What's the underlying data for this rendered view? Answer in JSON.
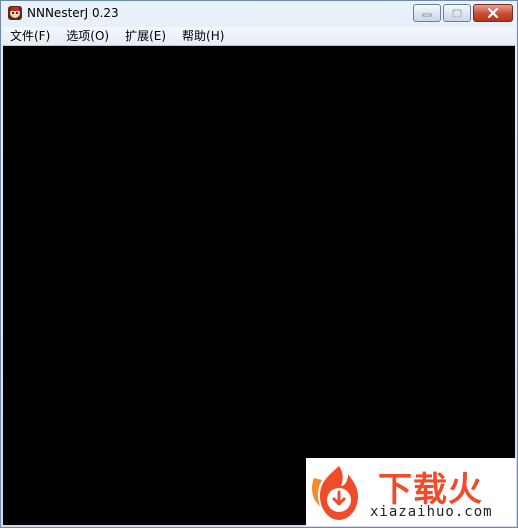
{
  "window": {
    "title": "NNNesterJ 0.23",
    "icon": "app-icon"
  },
  "controls": {
    "minimize_icon": "minimize-icon",
    "maximize_icon": "maximize-icon",
    "close_icon": "close-icon"
  },
  "menu": {
    "items": [
      {
        "label": "文件(F)"
      },
      {
        "label": "选项(O)"
      },
      {
        "label": "扩展(E)"
      },
      {
        "label": "帮助(H)"
      }
    ]
  },
  "watermark": {
    "text": "下载火",
    "url": "xiazaihuo.com",
    "logo": "flame-download-icon"
  },
  "colors": {
    "client_background": "#000000",
    "watermark_red": "#f04b2a"
  }
}
